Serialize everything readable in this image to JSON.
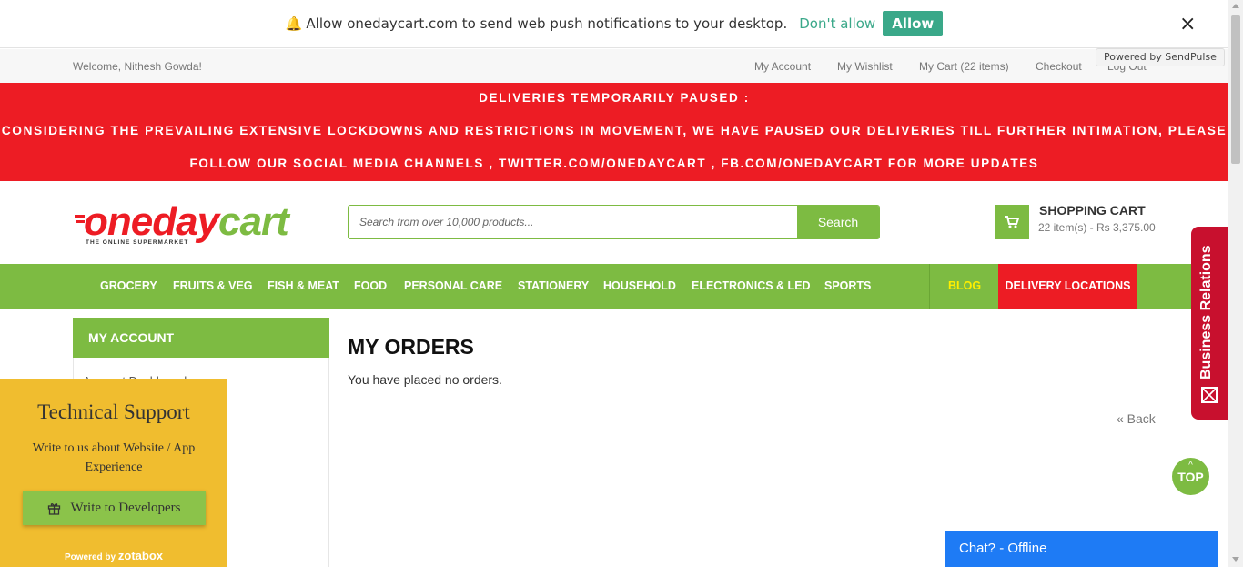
{
  "push": {
    "message": "Allow onedaycart.com to send web push notifications to your desktop.",
    "dont_allow": "Don't allow",
    "allow": "Allow",
    "close": "×",
    "powered_by": "Powered by SendPulse"
  },
  "top_links": {
    "welcome": "Welcome, Nithesh Gowda!",
    "my_account": "My Account",
    "my_wishlist": "My Wishlist",
    "my_cart": "My Cart (22 items)",
    "checkout": "Checkout",
    "logout": "Log Out"
  },
  "banner": {
    "line1": "DELIVERIES TEMPORARILY PAUSED :",
    "line2": "CONSIDERING THE PREVAILING EXTENSIVE LOCKDOWNS AND RESTRICTIONS IN MOVEMENT, WE HAVE PAUSED OUR DELIVERIES TILL FURTHER INTIMATION, PLEASE",
    "line3": "FOLLOW OUR SOCIAL MEDIA CHANNELS , TWITTER.COM/ONEDAYCART , FB.COM/ONEDAYCART FOR MORE UPDATES",
    "color": "#ed1c24"
  },
  "header": {
    "logo_one": "oneday",
    "logo_cart": "cart",
    "logo_tagline": "THE ONLINE SUPERMARKET",
    "search_placeholder": "Search from over 10,000 products...",
    "search_button": "Search",
    "cart_title": "SHOPPING CART",
    "cart_summary": "22 item(s) - Rs 3,375.00"
  },
  "nav": {
    "items": [
      "GROCERY",
      "FRUITS & VEG",
      "FISH & MEAT",
      "FOOD",
      "PERSONAL CARE",
      "STATIONERY",
      "HOUSEHOLD",
      "ELECTRONICS & LED",
      "SPORTS"
    ],
    "blog": "BLOG",
    "delivery": "DELIVERY LOCATIONS",
    "accent": "#7dbb42"
  },
  "sidebar": {
    "title": "MY ACCOUNT",
    "first_link": "Account Dashboard"
  },
  "main": {
    "title": "MY ORDERS",
    "message": "You have placed no orders.",
    "back": "« Back"
  },
  "top_button": {
    "arrow": "^",
    "label": "TOP"
  },
  "business_tab": {
    "label": "Business Relations"
  },
  "support": {
    "title": "Technical Support",
    "text": "Write to us about Website / App Experience",
    "button": "Write to Developers",
    "powered_prefix": "Powered by",
    "powered_brand": "zotabox"
  },
  "chat": {
    "label": "Chat? - Offline"
  }
}
